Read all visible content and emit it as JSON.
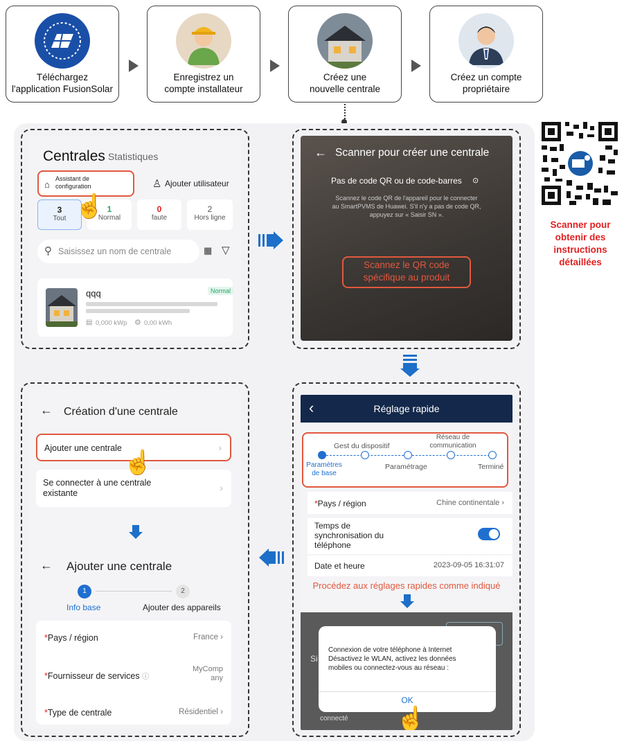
{
  "steps": [
    {
      "label": "Téléchargez\nl'application FusionSolar",
      "icon": "fusionsolar-app-icon"
    },
    {
      "label": "Enregistrez un\ncompte installateur",
      "icon": "installer-avatar-icon"
    },
    {
      "label": "Créez une\nnouvelle centrale",
      "icon": "house-icon"
    },
    {
      "label": "Créez un compte\npropriétaire",
      "icon": "owner-avatar-icon"
    }
  ],
  "qr": {
    "caption": "Scanner pour\nobtenir des\ninstructions\ndétaillées"
  },
  "screen1": {
    "title": "Centrales",
    "tab2": "Statistiques",
    "assistant": "Assistant de\nconfiguration",
    "add_user": "Ajouter utilisateur",
    "stats": [
      {
        "count": "3",
        "label": "Tout"
      },
      {
        "count": "1",
        "label": "Normal"
      },
      {
        "count": "0",
        "label": "faute"
      },
      {
        "count": "2",
        "label": "Hors ligne"
      }
    ],
    "search_placeholder": "Saisissez un nom de centrale",
    "plant": {
      "name": "qqq",
      "status": "Normal",
      "power": "0,000 kWp",
      "energy": "0,00 kWh"
    }
  },
  "screen2": {
    "title": "Scanner pour créer une centrale",
    "no_code": "Pas de code QR ou de code-barres",
    "help": "Scannez le code QR de l'appareil pour le connecter\nau SmartPVMS de Huawei. S'il n'y a pas de code QR,\nappuyez sur « Saisir SN ».",
    "scan_hint": "Scannez le QR code\nspécifique au produit"
  },
  "screen3": {
    "title": "Création d'une centrale",
    "option1": "Ajouter une centrale",
    "option2": "Se connecter à une centrale\nexistante",
    "title2": "Ajouter une centrale",
    "step1_num": "1",
    "step1": "Info base",
    "step2_num": "2",
    "step2": "Ajouter des appareils",
    "rows": [
      {
        "label": "Pays / région",
        "value": "France"
      },
      {
        "label": "Fournisseur de services",
        "value": "MyComp\nany"
      },
      {
        "label": "Type de centrale",
        "value": "Résidentiel"
      }
    ]
  },
  "screen4": {
    "title": "Réglage rapide",
    "steps_top": [
      "Gest du dispositif",
      "Réseau de\ncommunication"
    ],
    "steps_bottom": [
      "Paramètres\nde base",
      "Paramétrage",
      "Terminé"
    ],
    "country_label": "Pays / région",
    "country_value": "Chine continentale",
    "sync_label": "Temps de\nsynchronisation du\ntéléphone",
    "date_label": "Date et heure",
    "date_value": "2023-09-05 16:31:07",
    "caption": "Procédez aux réglages rapides comme indiqué",
    "dialog": "Connexion de votre téléphone à Internet\nDésactivez le WLAN, activez les données\nmobiles ou connectez-vous au réseau :",
    "ok": "OK",
    "bg_text1": "Si",
    "bg_text2": "connecté"
  },
  "colors": {
    "accent": "#1f6fd1",
    "orange": "#e2583e",
    "red": "#e02020",
    "navy": "#13284b"
  }
}
